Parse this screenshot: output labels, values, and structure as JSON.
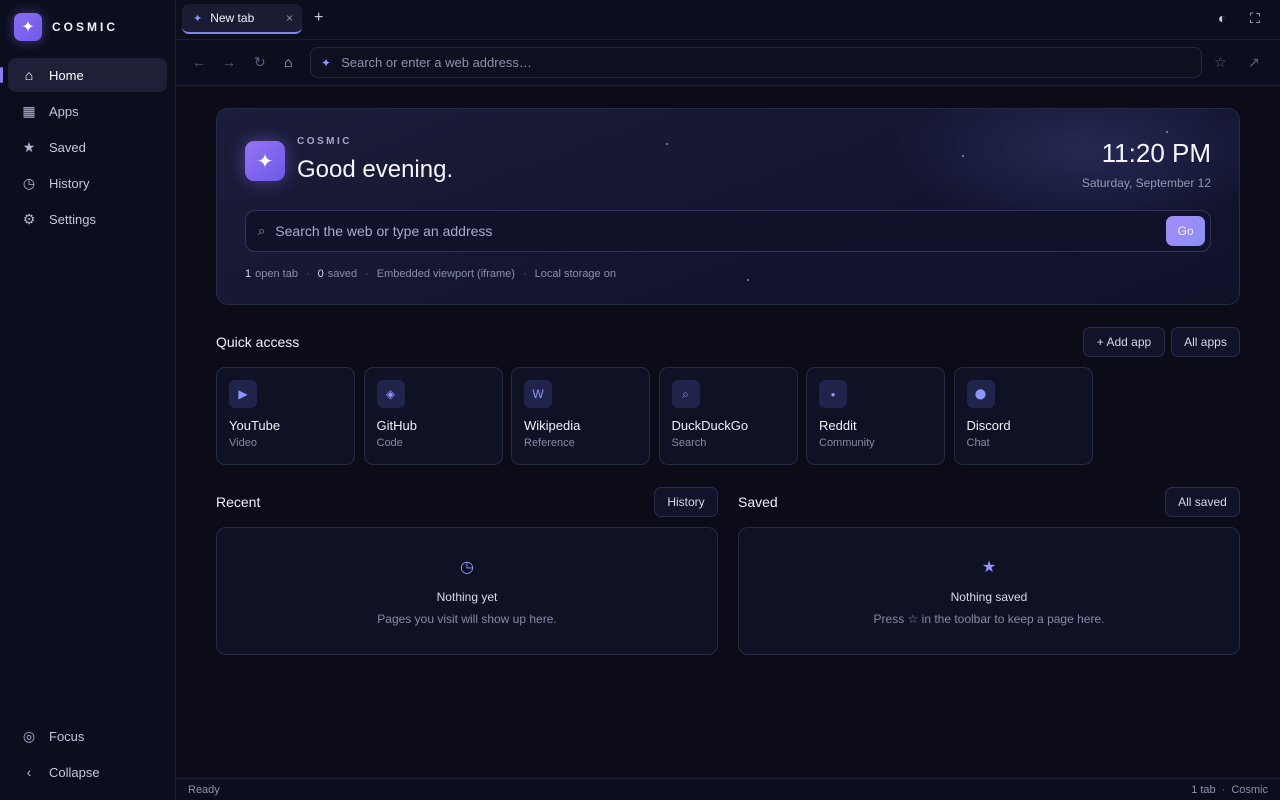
{
  "brand": {
    "name": "COSMIC",
    "logo_icon": "✦"
  },
  "sidebar": {
    "items": [
      {
        "label": "Home",
        "icon": "⌂",
        "active": true
      },
      {
        "label": "Apps",
        "icon": "▦",
        "active": false
      },
      {
        "label": "Saved",
        "icon": "★",
        "active": false
      },
      {
        "label": "History",
        "icon": "◷",
        "active": false
      },
      {
        "label": "Settings",
        "icon": "⚙",
        "active": false
      }
    ],
    "bottom": [
      {
        "label": "Focus",
        "icon": "◎"
      },
      {
        "label": "Collapse",
        "icon": "‹"
      }
    ]
  },
  "tabs": [
    {
      "label": "New tab",
      "icon": "✦",
      "close": "×"
    }
  ],
  "tabbar": {
    "new_tab": "+",
    "theme_icon": "◐",
    "fullscreen_icon": "⛶"
  },
  "toolbar": {
    "back": "←",
    "forward": "→",
    "reload": "↻",
    "home": "⌂",
    "address_icon": "✦",
    "address_placeholder": "Search or enter a web address…",
    "bookmark": "☆",
    "external": "↗"
  },
  "hero": {
    "logo_icon": "✦",
    "eyebrow": "COSMIC",
    "greeting": "Good evening.",
    "time": "11:20 PM",
    "date": "Saturday, September 12",
    "search_icon": "⌕",
    "search_placeholder": "Search the web or type an address",
    "go": "Go",
    "meta": {
      "open_tabs_count": "1",
      "open_tabs_label": "open tab",
      "saved_count": "0",
      "saved_label": "saved",
      "viewport": "Embedded viewport (iframe)",
      "storage": "Local storage on",
      "separator": "·"
    }
  },
  "quick_access": {
    "title": "Quick access",
    "add_app": "+ Add app",
    "all_apps": "All apps",
    "apps": [
      {
        "name": "YouTube",
        "category": "Video",
        "icon": "▶"
      },
      {
        "name": "GitHub",
        "category": "Code",
        "icon": "◈"
      },
      {
        "name": "Wikipedia",
        "category": "Reference",
        "icon": "W"
      },
      {
        "name": "DuckDuckGo",
        "category": "Search",
        "icon": "⌕"
      },
      {
        "name": "Reddit",
        "category": "Community",
        "icon": "●"
      },
      {
        "name": "Discord",
        "category": "Chat",
        "icon": "⬤"
      }
    ]
  },
  "recent": {
    "title": "Recent",
    "button": "History",
    "icon": "◷",
    "empty_title": "Nothing yet",
    "empty_sub": "Pages you visit will show up here."
  },
  "saved": {
    "title": "Saved",
    "button": "All saved",
    "icon": "★",
    "empty_title": "Nothing saved",
    "empty_sub": "Press ☆ in the toolbar to keep a page here."
  },
  "status": {
    "left": "Ready",
    "tabs": "1 tab",
    "separator": "·",
    "app": "Cosmic"
  },
  "colors": {
    "accent": "#8b7cf6",
    "background": "#0b0c18",
    "panel": "#0f1124"
  }
}
